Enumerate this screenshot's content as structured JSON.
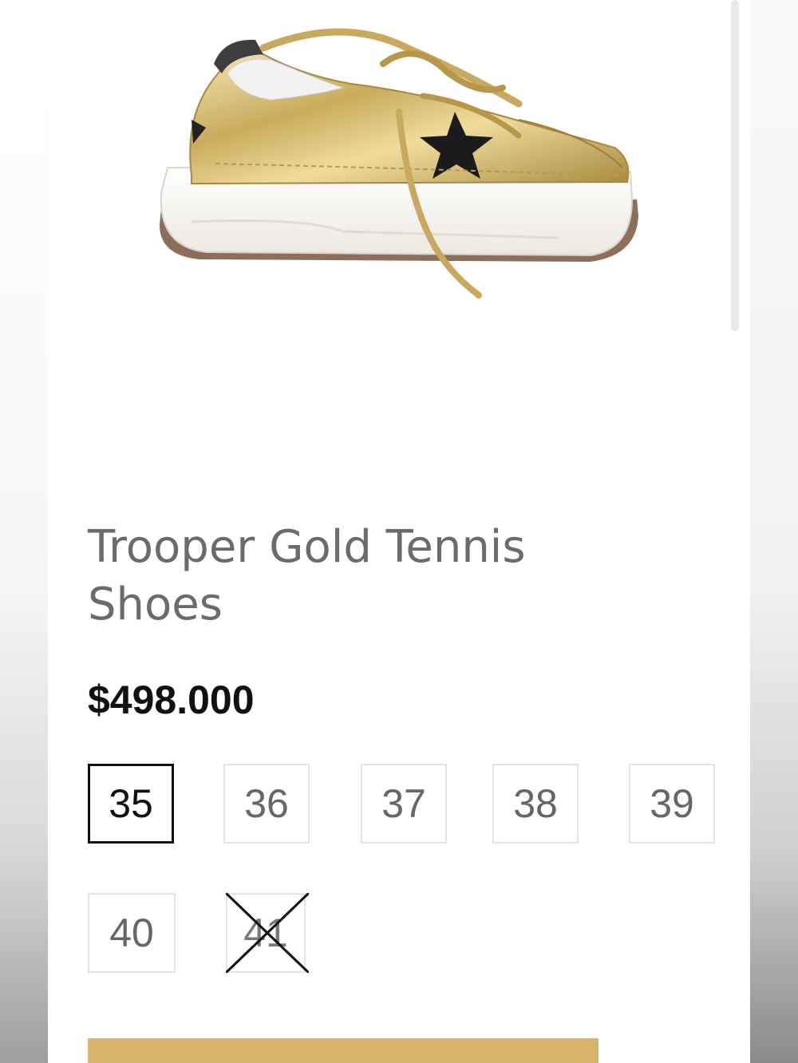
{
  "product": {
    "title": "Trooper Gold Tennis Shoes",
    "price": "$498.000",
    "image_alt_icon": "gold-sneaker-with-black-star"
  },
  "sizes": [
    {
      "label": "35",
      "state": "selected"
    },
    {
      "label": "36",
      "state": "available"
    },
    {
      "label": "37",
      "state": "available"
    },
    {
      "label": "38",
      "state": "available"
    },
    {
      "label": "39",
      "state": "available"
    },
    {
      "label": "40",
      "state": "available"
    },
    {
      "label": "41",
      "state": "unavailable"
    }
  ],
  "colors": {
    "accent": "#d7b46a",
    "title": "#6b6b6b",
    "price": "#111111",
    "size_border": "#e3e3e3"
  }
}
